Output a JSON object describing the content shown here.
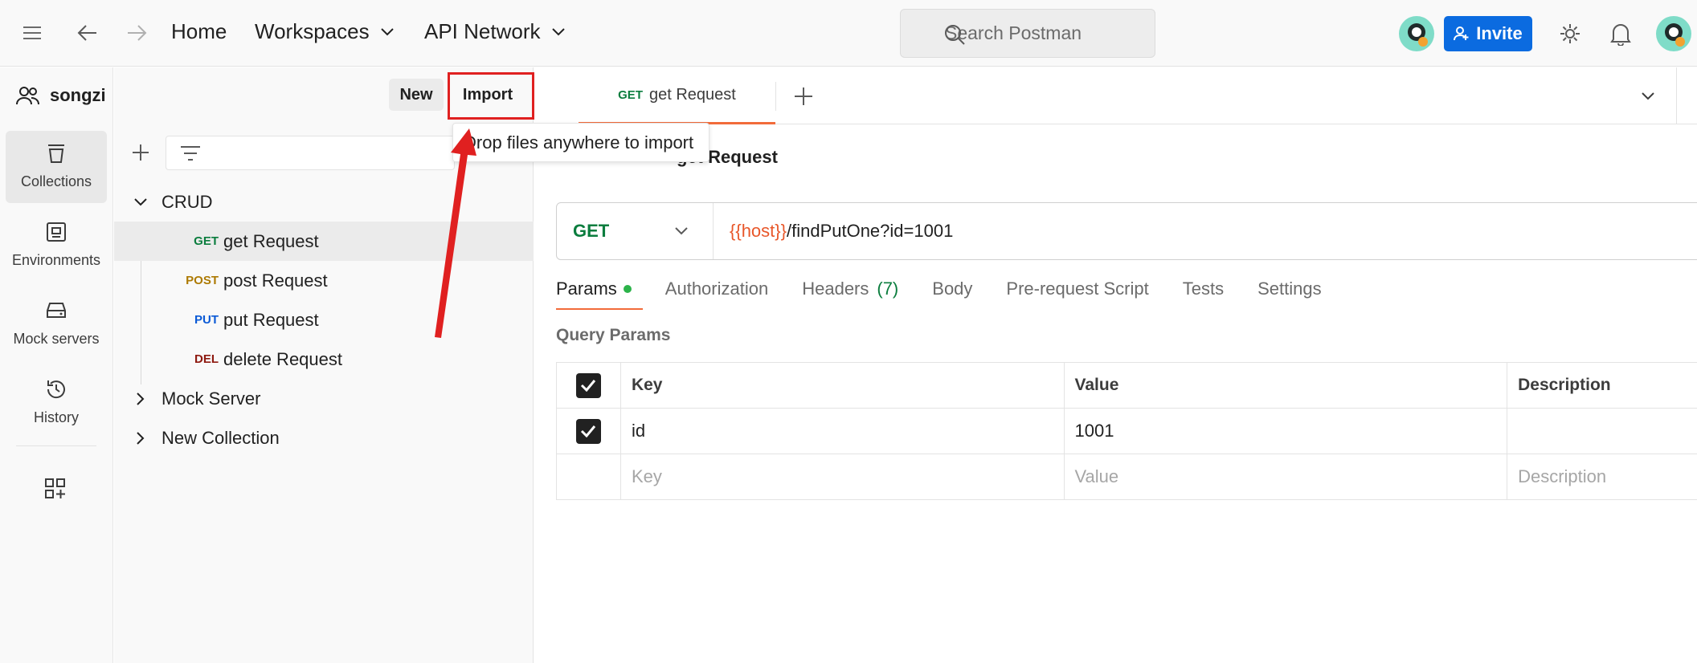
{
  "topbar": {
    "home": "Home",
    "workspaces": "Workspaces",
    "api_network": "API Network",
    "search_placeholder": "Search Postman",
    "invite": "Invite"
  },
  "rail": {
    "items": [
      {
        "label": "Collections",
        "icon": "collections-icon"
      },
      {
        "label": "Environments",
        "icon": "environments-icon"
      },
      {
        "label": "Mock servers",
        "icon": "mock-servers-icon"
      },
      {
        "label": "History",
        "icon": "history-icon"
      }
    ]
  },
  "sidebar": {
    "workspace_name": "songzi",
    "new_label": "New",
    "import_label": "Import",
    "tree": {
      "collection_1": "CRUD",
      "requests": [
        {
          "method": "GET",
          "name": "get Request"
        },
        {
          "method": "POST",
          "name": "post Request"
        },
        {
          "method": "PUT",
          "name": "put Request"
        },
        {
          "method": "DEL",
          "name": "delete Request"
        }
      ],
      "collection_2": "Mock Server",
      "collection_3": "New Collection"
    }
  },
  "tooltip": {
    "text": "Drop files anywhere to import"
  },
  "main": {
    "tab": {
      "method": "GET",
      "name": "get Request"
    },
    "breadcrumb_title": "get Request",
    "url": {
      "method": "GET",
      "variable": "{{host}}",
      "path": "/findPutOne?id=1001"
    },
    "request_tabs": {
      "params": "Params",
      "authorization": "Authorization",
      "headers": "Headers",
      "headers_count": "(7)",
      "body": "Body",
      "prerequest": "Pre-request Script",
      "tests": "Tests",
      "settings": "Settings"
    },
    "query_params_label": "Query Params",
    "table": {
      "headers": {
        "key": "Key",
        "value": "Value",
        "description": "Description"
      },
      "row": {
        "key": "id",
        "value": "1001",
        "description": ""
      },
      "placeholders": {
        "key": "Key",
        "value": "Value",
        "description": "Description"
      }
    }
  },
  "colors": {
    "accent": "#f26b3a",
    "invite": "#0b6be0",
    "annotation": "#e02020",
    "get": "#0b7d3e",
    "post": "#ad7a03",
    "put": "#0b5ad6",
    "del": "#8e1a10"
  }
}
